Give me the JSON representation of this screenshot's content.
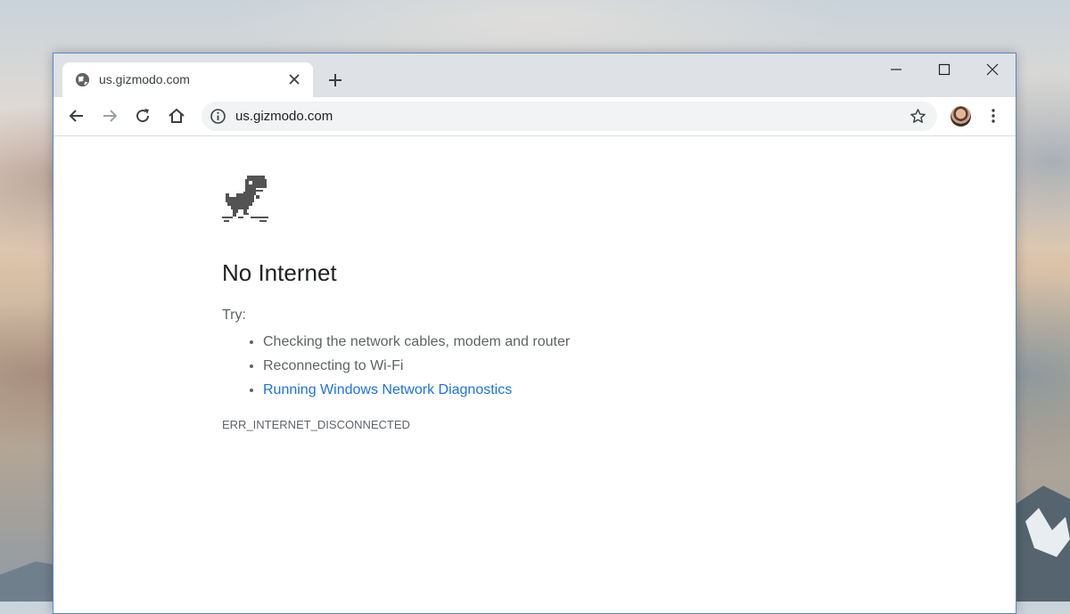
{
  "tab": {
    "title": "us.gizmodo.com",
    "favicon": "globe-icon",
    "close": "close-icon"
  },
  "toolbar": {
    "back": "arrow-left-icon",
    "forward": "arrow-right-icon",
    "reload": "reload-icon",
    "home": "home-icon",
    "url": "us.gizmodo.com",
    "site_info": "info-icon",
    "bookmark": "star-icon",
    "menu": "kebab-icon"
  },
  "page": {
    "title": "No Internet",
    "try_label": "Try:",
    "suggestions": [
      "Checking the network cables, modem and router",
      "Reconnecting to Wi-Fi",
      "Running Windows Network Diagnostics"
    ],
    "error_code": "ERR_INTERNET_DISCONNECTED"
  },
  "colors": {
    "accent_link": "#1a73e8",
    "tabstrip": "#dee1e6",
    "text_primary": "#202124",
    "text_secondary": "#5f6368"
  }
}
